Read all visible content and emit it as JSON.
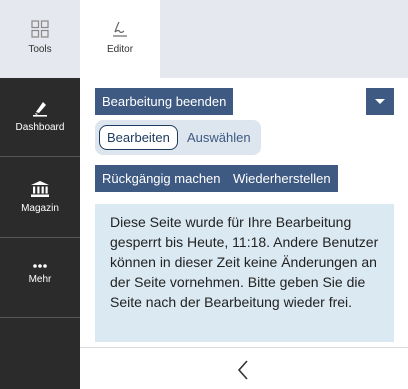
{
  "sidebar": {
    "tools_label": "Tools",
    "items": [
      {
        "label": "Dashboard",
        "icon": "pen-icon"
      },
      {
        "label": "Magazin",
        "icon": "bank-icon"
      },
      {
        "label": "Mehr",
        "icon": "more-icon"
      }
    ]
  },
  "tabs": {
    "editor_label": "Editor"
  },
  "toolbar": {
    "finish_label": "Bearbeitung beenden",
    "mode_edit": "Bearbeiten",
    "mode_select": "Auswählen",
    "undo_label": "Rückgängig machen",
    "redo_label": "Wiederherstellen"
  },
  "notice": {
    "text": "Diese Seite wurde für Ihre Bearbeitung gesperrt bis Heute, 11:18. Andere Benut­zer können in dieser Zeit keine Änderun­gen an der Seite vornehmen. Bitte geben Sie die Seite nach der Bearbeitung wie­der frei."
  },
  "colors": {
    "accent": "#3e5a82",
    "rail": "#2b2b2b",
    "notice_bg": "#dbe9f3"
  }
}
